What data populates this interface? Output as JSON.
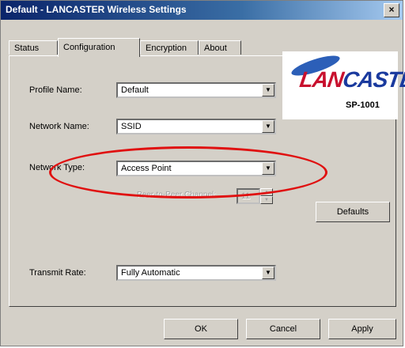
{
  "window": {
    "title": "Default - LANCASTER Wireless Settings",
    "close_glyph": "×"
  },
  "tabs": [
    {
      "label": "Status"
    },
    {
      "label": "Configuration"
    },
    {
      "label": "Encryption"
    },
    {
      "label": "About"
    }
  ],
  "active_tab": "Configuration",
  "form": {
    "profile_name": {
      "label": "Profile Name:",
      "value": "Default"
    },
    "network_name": {
      "label": "Network Name:",
      "value": "SSID"
    },
    "network_type": {
      "label": "Network Type:",
      "value": "Access Point"
    },
    "channel": {
      "label": "Peer-to-Peer Channel:",
      "value": "11"
    },
    "transmit_rate": {
      "label": "Transmit Rate:",
      "value": "Fully Automatic"
    }
  },
  "buttons": {
    "defaults": "Defaults",
    "ok": "OK",
    "cancel": "Cancel",
    "apply": "Apply"
  },
  "logo": {
    "brand": "LANCASTER",
    "model": "SP-1001"
  },
  "colors": {
    "highlight": "#e01010",
    "titlebar": "#0a246a",
    "brand_blue": "#1a3a9e",
    "brand_red": "#c8102e"
  }
}
